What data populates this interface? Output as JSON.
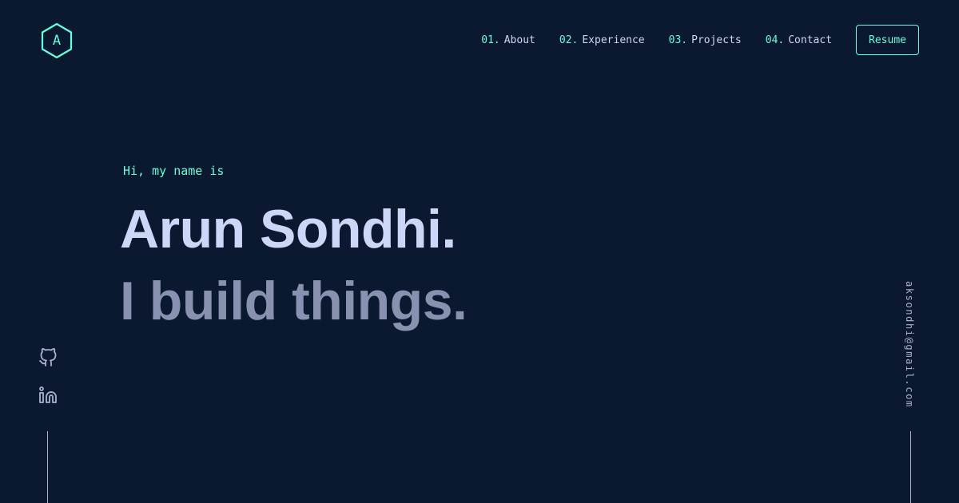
{
  "logo": {
    "letter": "A",
    "icon": "hexagon-logo-icon",
    "accent": "#64ffda"
  },
  "nav": {
    "items": [
      {
        "number": "01.",
        "label": "About"
      },
      {
        "number": "02.",
        "label": "Experience"
      },
      {
        "number": "03.",
        "label": "Projects"
      },
      {
        "number": "04.",
        "label": "Contact"
      }
    ],
    "resume_label": "Resume"
  },
  "hero": {
    "intro": "Hi, my name is",
    "name": "Arun Sondhi.",
    "tagline": "I build things."
  },
  "social": {
    "icons": [
      "github-icon",
      "linkedin-icon"
    ]
  },
  "email": "aksondhi@gmail.com",
  "colors": {
    "background": "#0b1930",
    "accent": "#64ffda",
    "heading": "#ccd6f6",
    "subheading": "#8892b0",
    "muted": "#a8b2d1"
  }
}
